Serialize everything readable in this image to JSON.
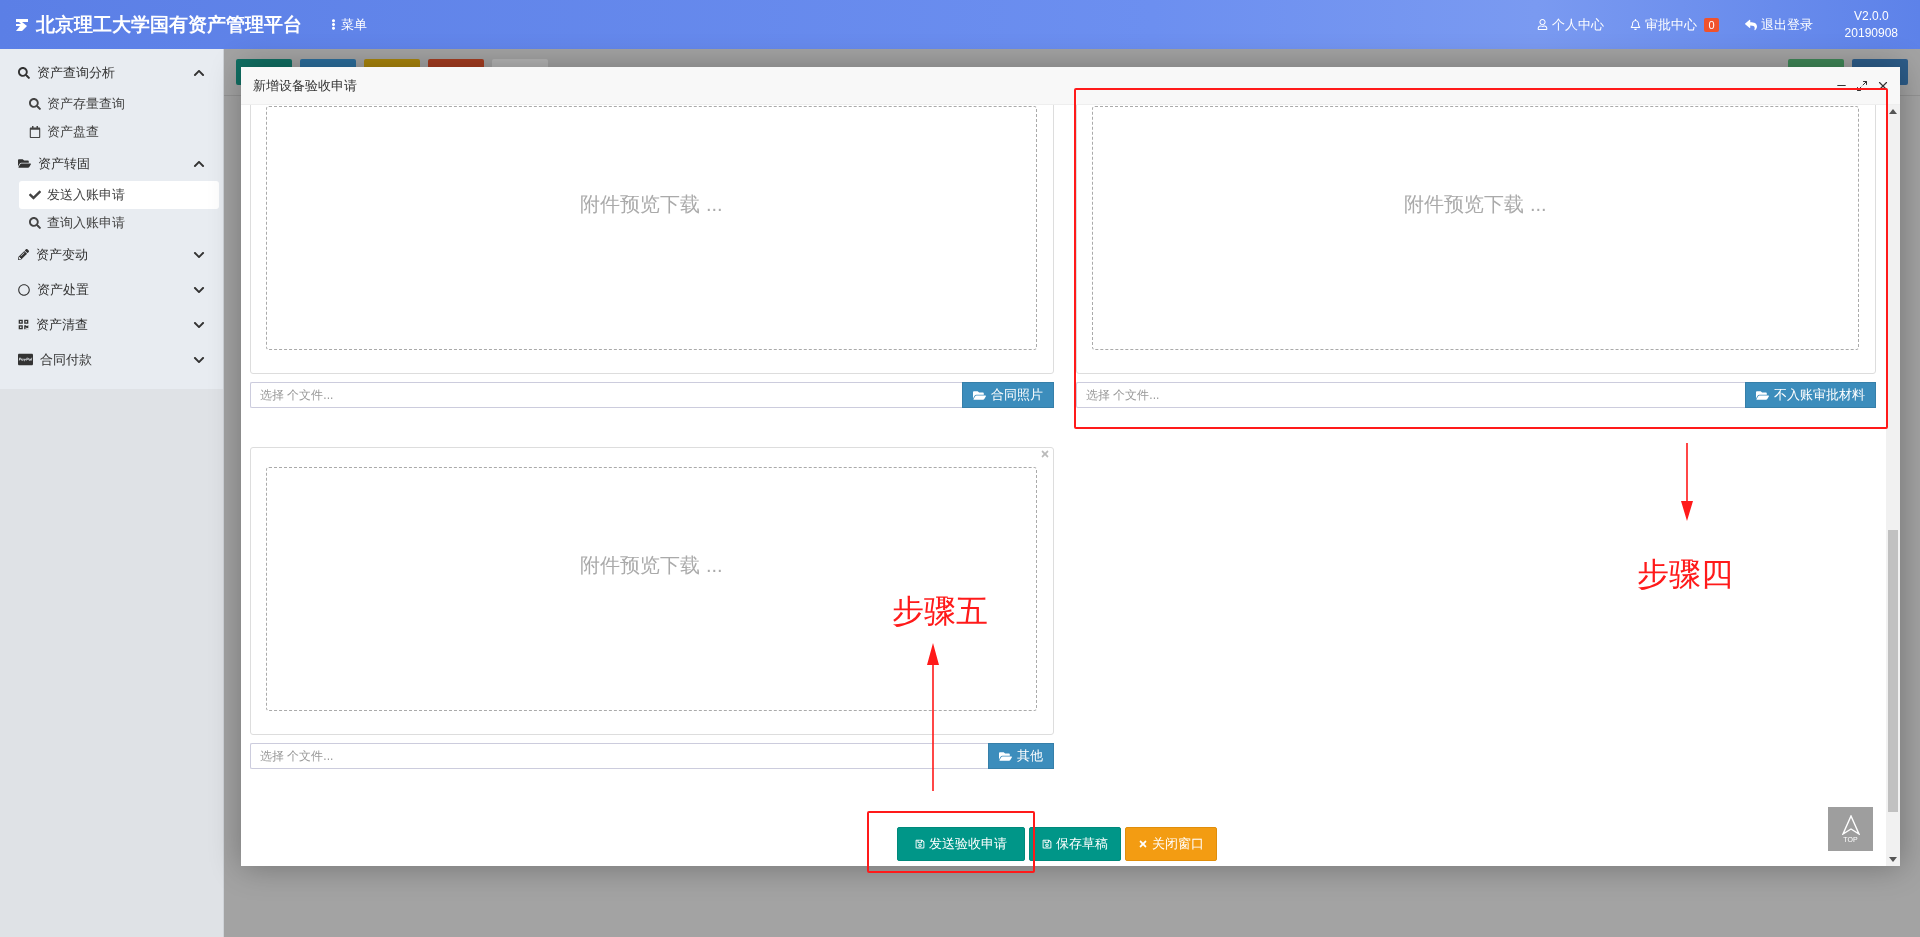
{
  "header": {
    "title": "北京理工大学国有资产管理平台",
    "menu_label": "菜单",
    "links": [
      {
        "kind": "user",
        "label": "个人中心"
      },
      {
        "kind": "bell",
        "label": "审批中心",
        "badge": "0"
      },
      {
        "kind": "logout",
        "label": "退出登录"
      }
    ],
    "version": "V2.0.0",
    "build": "20190908"
  },
  "sidebar": {
    "groups": [
      {
        "kind": "search",
        "label": "资产查询分析",
        "expanded": true,
        "children": [
          {
            "kind": "search",
            "label": "资产存量查询",
            "selected": false
          },
          {
            "kind": "calendar",
            "label": "资产盘查",
            "selected": false
          }
        ]
      },
      {
        "kind": "folder",
        "label": "资产转固",
        "expanded": true,
        "children": [
          {
            "kind": "check",
            "label": "发送入账申请",
            "selected": true
          },
          {
            "kind": "search",
            "label": "查询入账申请",
            "selected": false
          }
        ]
      },
      {
        "kind": "pencil",
        "label": "资产变动",
        "expanded": false
      },
      {
        "kind": "circle",
        "label": "资产处置",
        "expanded": false
      },
      {
        "kind": "qrcode",
        "label": "资产清查",
        "expanded": false
      },
      {
        "kind": "card",
        "label": "合同付款",
        "expanded": false
      }
    ]
  },
  "dialog": {
    "title": "新增设备验收申请",
    "attachments": [
      {
        "preview_text": "附件预览下载 ...",
        "placeholder": "选择 个文件...",
        "button": "合同照片"
      },
      {
        "preview_text": "附件预览下载 ...",
        "placeholder": "选择 个文件...",
        "button": "不入账审批材料"
      },
      {
        "preview_text": "附件预览下载 ...",
        "placeholder": "选择 个文件...",
        "button": "其他",
        "closable": true
      }
    ],
    "buttons": [
      {
        "kind": "primary",
        "label": "发送验收申请"
      },
      {
        "kind": "primary",
        "label": "保存草稿"
      },
      {
        "kind": "warning",
        "label": "关闭窗口"
      }
    ],
    "top_button": "TOP"
  },
  "annotations": [
    {
      "label": "步骤四"
    },
    {
      "label": "步骤五"
    }
  ]
}
